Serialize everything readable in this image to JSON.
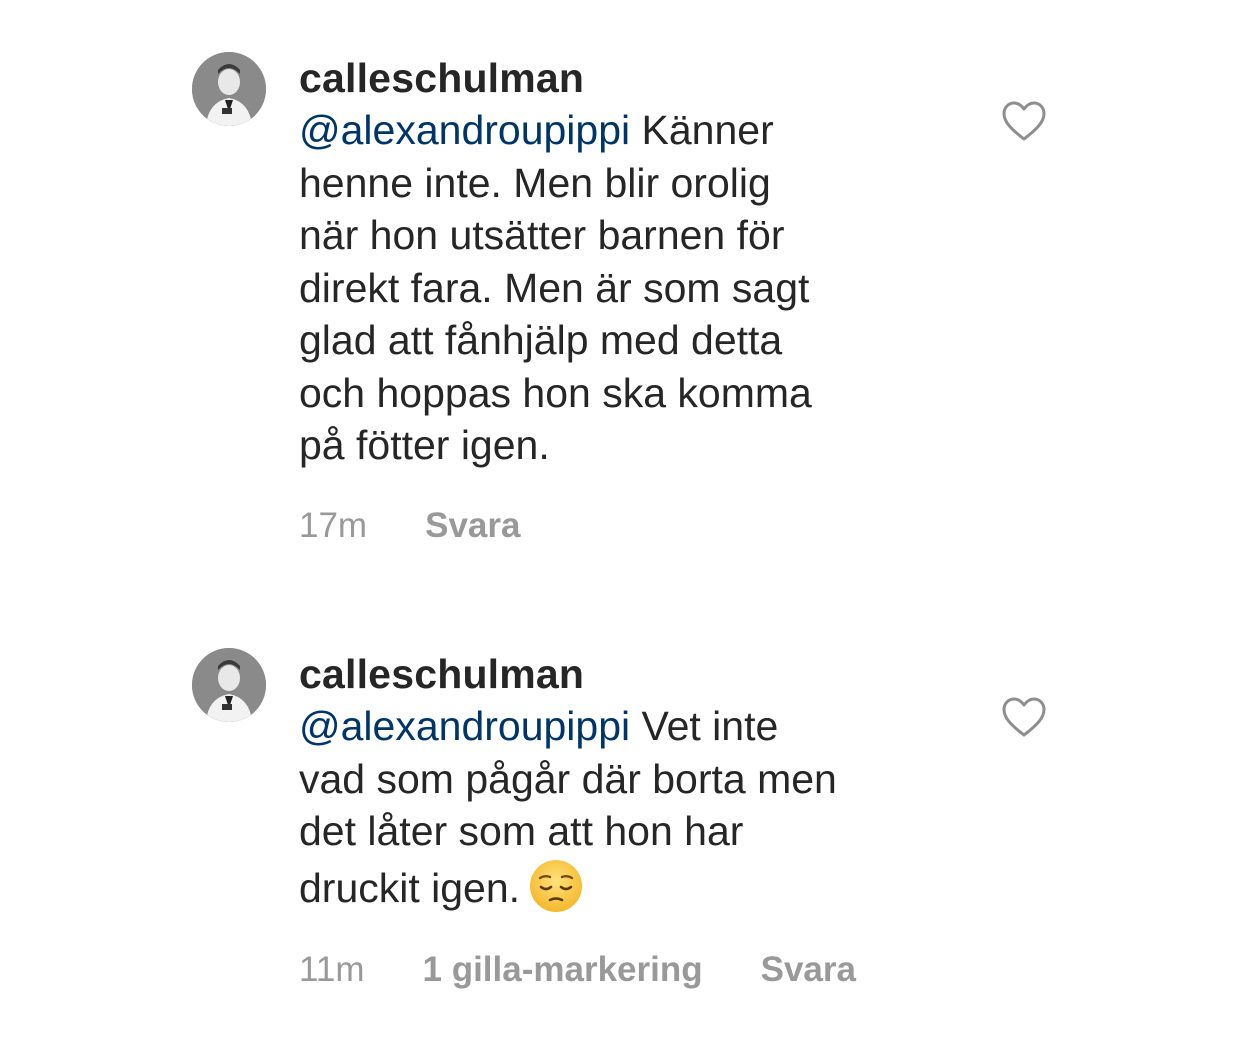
{
  "comments": [
    {
      "username": "calleschulman",
      "mention": "@alexandroupippi",
      "text": " Känner\nhenne inte. Men blir orolig\nnär hon utsätter barnen för\ndirekt fara. Men är som sagt\nglad att fånhjälp med detta\noch hoppas hon ska komma\npå fötter igen.",
      "time": "17m",
      "reply": "Svara",
      "heart_icon": "heart-outline-icon"
    },
    {
      "username": "calleschulman",
      "mention": "@alexandroupippi",
      "text": " Vet inte\nvad som pågår där borta men\ndet låter som att hon har\ndruckit igen.",
      "emoji": "pensive-face-emoji",
      "time": "11m",
      "likes": "1 gilla-markering",
      "reply": "Svara",
      "heart_icon": "heart-outline-icon"
    }
  ]
}
